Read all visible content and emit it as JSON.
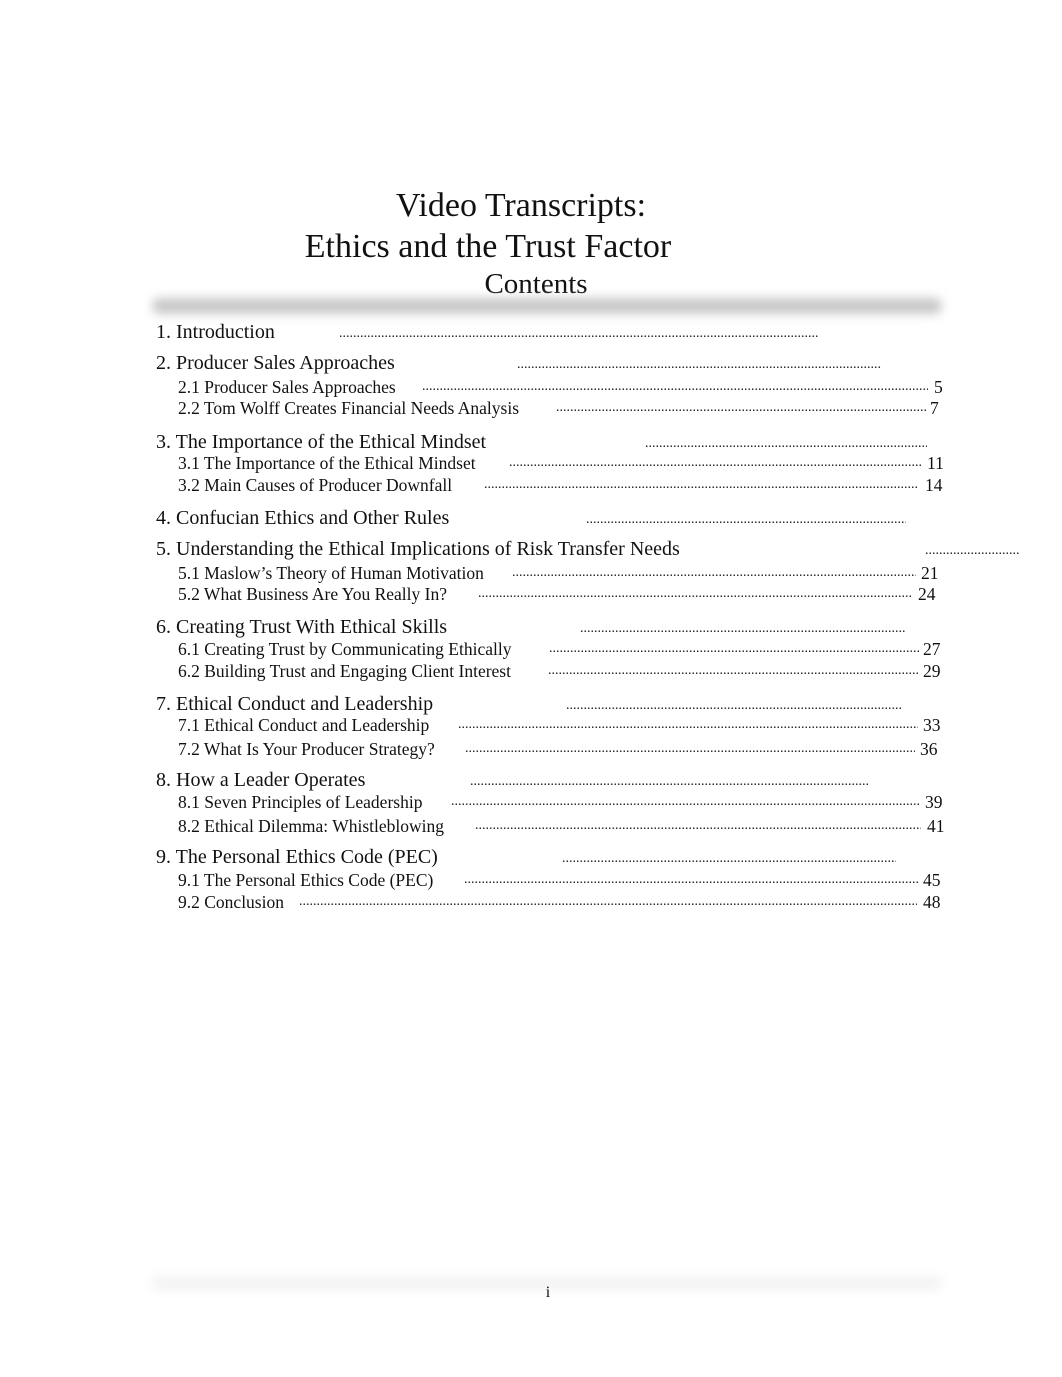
{
  "document": {
    "title_line1": "Video Transcripts:",
    "title_line2": "Ethics and the Trust Factor",
    "contents_heading": "Contents",
    "footer_page_number": "i"
  },
  "toc": [
    {
      "label": "1. Introduction",
      "page": "",
      "subs": []
    },
    {
      "label": "2. Producer Sales Approaches",
      "page": "",
      "subs": [
        {
          "label": "2.1 Producer Sales Approaches",
          "page": "5"
        },
        {
          "label": "2.2 Tom Wolff Creates Financial Needs Analysis",
          "page": "7"
        }
      ]
    },
    {
      "label": "3. The Importance of the Ethical Mindset",
      "page": "",
      "subs": [
        {
          "label": "3.1 The Importance of the Ethical Mindset",
          "page": "11"
        },
        {
          "label": "3.2 Main Causes of Producer Downfall",
          "page": "14"
        }
      ]
    },
    {
      "label": "4. Confucian Ethics and Other Rules",
      "page": "",
      "subs": []
    },
    {
      "label": "5. Understanding the Ethical Implications of Risk Transfer Needs",
      "page": "",
      "subs": [
        {
          "label": "5.1 Maslow’s Theory of Human Motivation",
          "page": "21"
        },
        {
          "label": "5.2 What Business Are You Really In?",
          "page": "24"
        }
      ]
    },
    {
      "label": "6. Creating Trust With Ethical Skills",
      "page": "",
      "subs": [
        {
          "label": "6.1 Creating Trust by Communicating Ethically",
          "page": "27"
        },
        {
          "label": "6.2 Building Trust and Engaging Client Interest",
          "page": "29"
        }
      ]
    },
    {
      "label": "7. Ethical Conduct and Leadership",
      "page": "",
      "subs": [
        {
          "label": "7.1 Ethical Conduct and Leadership",
          "page": "33"
        },
        {
          "label": "7.2 What Is Your Producer Strategy?",
          "page": "36"
        }
      ]
    },
    {
      "label": "8. How a Leader Operates",
      "page": "",
      "subs": [
        {
          "label": "8.1 Seven Principles of Leadership",
          "page": "39"
        },
        {
          "label": "8.2 Ethical Dilemma: Whistleblowing",
          "page": "41"
        }
      ]
    },
    {
      "label": "9. The Personal Ethics Code (PEC)",
      "page": "",
      "subs": [
        {
          "label": "9.1 The Personal Ethics Code (PEC)",
          "page": "45"
        },
        {
          "label": "9.2 Conclusion",
          "page": "48"
        }
      ]
    }
  ]
}
